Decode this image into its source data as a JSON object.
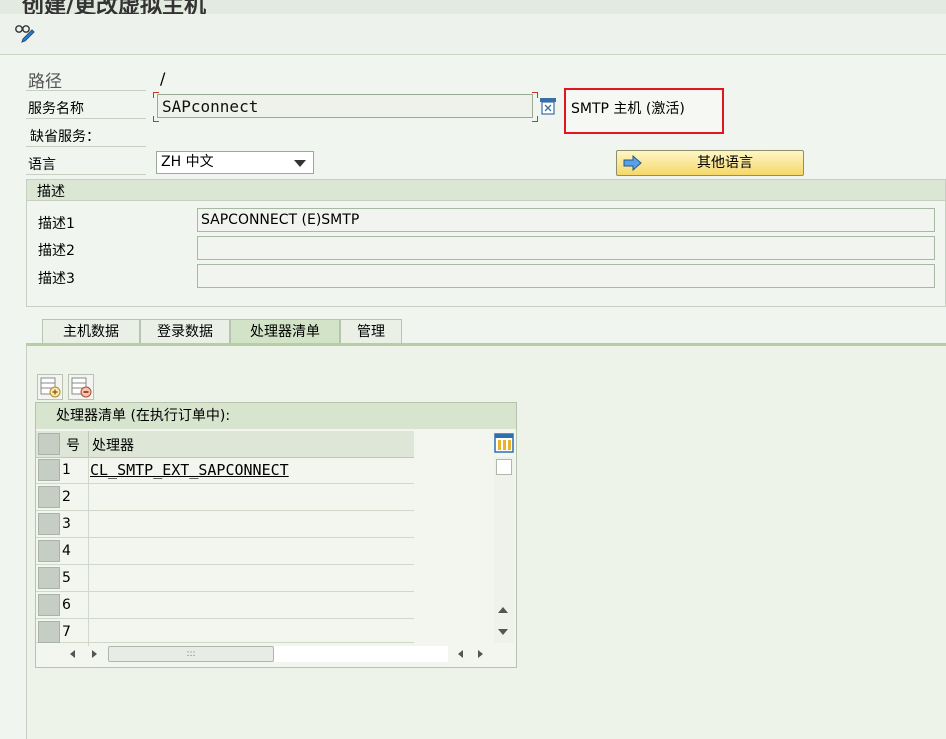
{
  "window": {
    "title": "创建/更改虚拟主机"
  },
  "form": {
    "path_label": "路径",
    "path_value": "/",
    "service_label": "服务名称",
    "service_value": "SAPconnect",
    "default_service_label": "缺省服务：",
    "language_label": "语言",
    "language_value": "ZH 中文",
    "other_language_button": "其他语言",
    "status_text": "SMTP 主机 (激活)"
  },
  "description": {
    "header": "描述",
    "fields": [
      {
        "label": "描述1",
        "value": "SAPCONNECT (E)SMTP"
      },
      {
        "label": "描述2",
        "value": ""
      },
      {
        "label": "描述3",
        "value": ""
      }
    ]
  },
  "tabs": [
    {
      "label": "主机数据"
    },
    {
      "label": "登录数据"
    },
    {
      "label": "处理器清单",
      "active": true
    },
    {
      "label": "管理"
    }
  ],
  "handler_table": {
    "title": "处理器清单 (在执行订单中):",
    "columns": [
      "号",
      "处理器"
    ],
    "rows": [
      {
        "no": "1",
        "handler": "CL_SMTP_EXT_SAPCONNECT"
      },
      {
        "no": "2",
        "handler": ""
      },
      {
        "no": "3",
        "handler": ""
      },
      {
        "no": "4",
        "handler": ""
      },
      {
        "no": "5",
        "handler": ""
      },
      {
        "no": "6",
        "handler": ""
      },
      {
        "no": "7",
        "handler": ""
      }
    ],
    "hscroll_thumb_glyph": ":::"
  },
  "colors": {
    "status_border": "#e2161f",
    "button_yellow": "#f5d869",
    "tab_active": "#d2e3c7"
  }
}
